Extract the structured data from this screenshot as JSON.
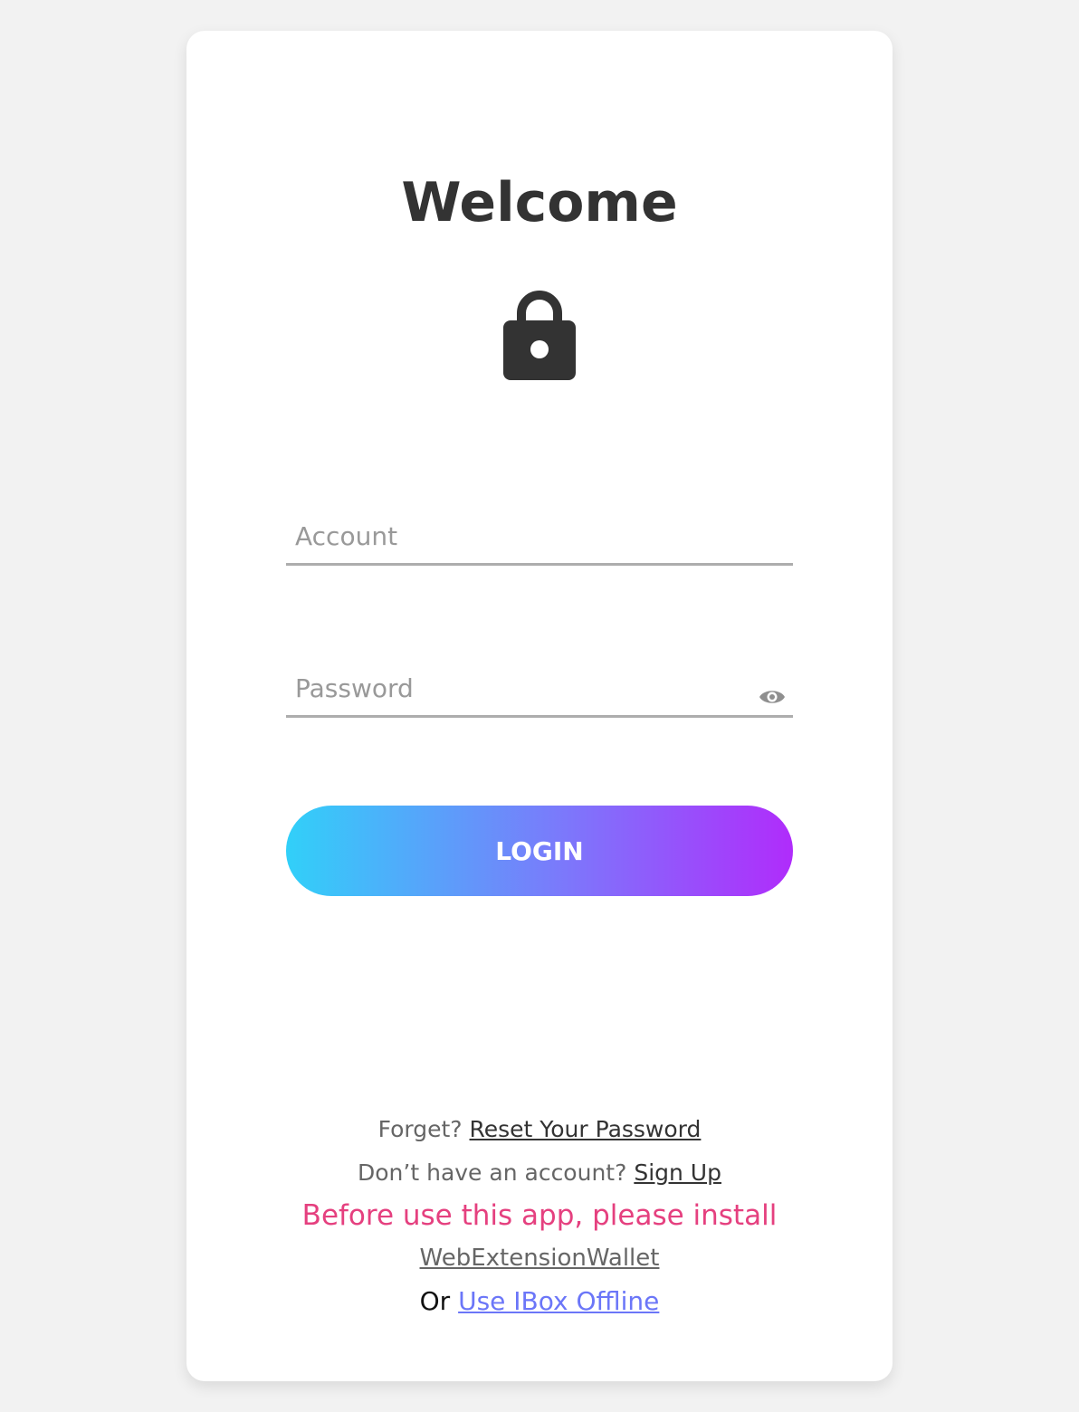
{
  "header": {
    "title": "Welcome"
  },
  "icons": {
    "lock": "lock-icon",
    "eye": "eye-icon"
  },
  "form": {
    "account": {
      "placeholder": "Account",
      "value": ""
    },
    "password": {
      "placeholder": "Password",
      "value": ""
    },
    "login_label": "LOGIN"
  },
  "footer": {
    "forget_text": "Forget?",
    "reset_link": "Reset Your Password",
    "no_account_text": "Don’t have an account?",
    "signup_link": "Sign Up",
    "install_notice": "Before use this app, please install",
    "wallet_link": "WebExtensionWallet",
    "or_text": "Or",
    "offline_link": "Use IBox Offline"
  },
  "colors": {
    "background": "#f2f2f2",
    "card": "#ffffff",
    "title": "#333333",
    "field_underline": "#adadad",
    "gradient_start": "#31d0f9",
    "gradient_end": "#b02cfb",
    "notice": "#e5407f",
    "offline_link": "#6b76f8"
  }
}
